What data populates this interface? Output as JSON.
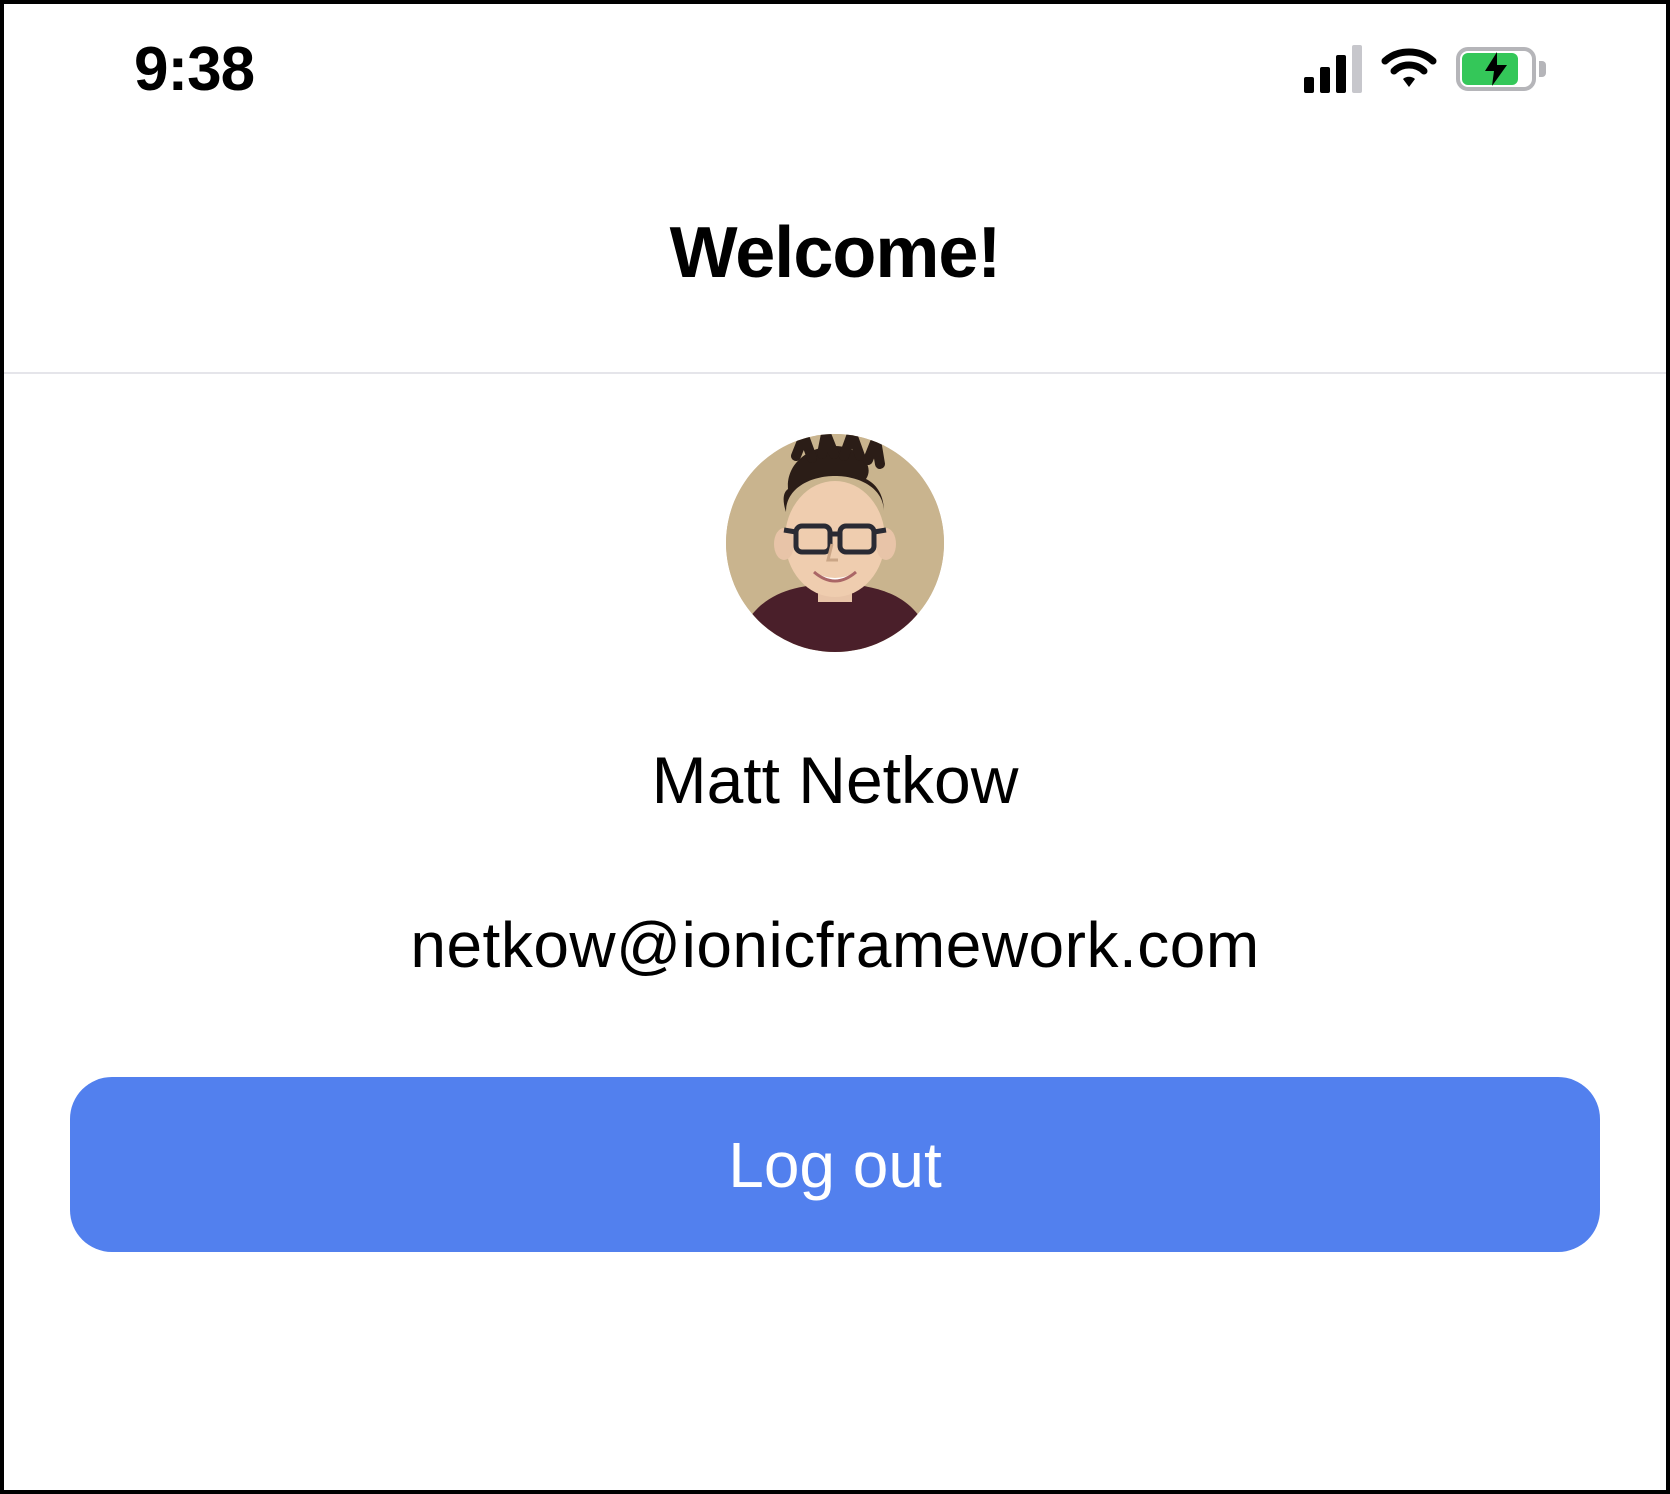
{
  "status_bar": {
    "time": "9:38",
    "cellular": {
      "bars_active": 3,
      "bars_total": 4
    },
    "wifi": "full",
    "battery": {
      "charging": true,
      "level_pct": 75,
      "color": "#34c759"
    }
  },
  "header": {
    "title": "Welcome!"
  },
  "profile": {
    "avatar_alt": "user-avatar",
    "name": "Matt Netkow",
    "email": "netkow@ionicframework.com"
  },
  "actions": {
    "logout_label": "Log out"
  },
  "colors": {
    "primary": "#5280ee",
    "divider": "#e5e5ea",
    "battery_green": "#34c759",
    "inactive_bar": "#c7c7cc"
  }
}
